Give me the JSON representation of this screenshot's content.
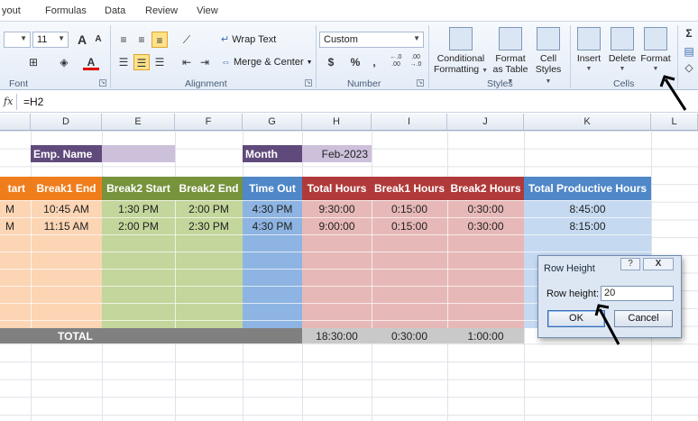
{
  "menu_tabs": [
    "yout",
    "Formulas",
    "Data",
    "Review",
    "View"
  ],
  "ribbon": {
    "font": {
      "size_value": "11",
      "grow_label": "A",
      "shrink_label": "A",
      "fill_label": "◇",
      "color_label": "A",
      "group_label": "Font"
    },
    "alignment": {
      "wrap_text": "Wrap Text",
      "merge_center": "Merge & Center",
      "group_label": "Alignment"
    },
    "number": {
      "format_value": "Custom",
      "currency": "$",
      "percent": "%",
      "comma": ",",
      "inc_dec_1": "←.0",
      "inc_dec_2": ".00",
      "inc_dec_3": ".00",
      "inc_dec_4": "→.0",
      "group_label": "Number"
    },
    "styles": {
      "conditional": [
        "Conditional",
        "Formatting"
      ],
      "format_table": [
        "Format",
        "as Table"
      ],
      "cell_styles": [
        "Cell",
        "Styles"
      ],
      "group_label": "Styles"
    },
    "cells": {
      "insert": "Insert",
      "delete": "Delete",
      "format": "Format",
      "group_label": "Cells"
    },
    "sigma": "Σ"
  },
  "formula_bar": {
    "fx_label": "fx",
    "formula": "=H2"
  },
  "columns": [
    "D",
    "E",
    "F",
    "G",
    "H",
    "I",
    "J",
    "K",
    "L"
  ],
  "sheet": {
    "emp_name_label": "Emp. Name",
    "month_label": "Month",
    "month_value": "Feb-2023",
    "headers": [
      "tart",
      "Break1 End",
      "Break2 Start",
      "Break2 End",
      "Time Out",
      "Total Hours",
      "Break1 Hours",
      "Break2 Hours",
      "Total Productive Hours"
    ],
    "rows": [
      [
        "M",
        "10:45 AM",
        "1:30 PM",
        "2:00 PM",
        "4:30 PM",
        "9:30:00",
        "0:15:00",
        "0:30:00",
        "8:45:00"
      ],
      [
        "M",
        "11:15 AM",
        "2:00 PM",
        "2:30 PM",
        "4:30 PM",
        "9:00:00",
        "0:15:00",
        "0:30:00",
        "8:15:00"
      ]
    ],
    "total_label": "TOTAL",
    "totals": [
      "18:30:00",
      "0:30:00",
      "1:00:00"
    ]
  },
  "dialog": {
    "title": "Row Height",
    "help": "?",
    "close": "X",
    "label": "Row height:",
    "value": "20",
    "ok": "OK",
    "cancel": "Cancel"
  },
  "colors": {
    "orange": "#f07d1c",
    "green": "#77933c",
    "blue": "#4f87c8",
    "red": "#b03a3a",
    "purple": "#604a7b",
    "light_orange": "#fcd5b4",
    "light_green": "#c3d69b",
    "light_blue": "#8db4e2",
    "light_red": "#e6b8b7",
    "light_purple": "#ccc0da",
    "light_steel": "#c5d9f1",
    "gray": "#808080"
  }
}
